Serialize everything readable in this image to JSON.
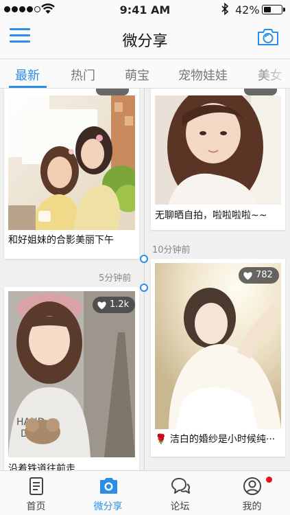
{
  "status_bar": {
    "time": "9:41 AM",
    "battery_percent": "42%",
    "battery_level": 0.42,
    "signal_filled_dots": 4,
    "icons": [
      "signal-dots-icon",
      "wifi-icon",
      "bluetooth-icon",
      "battery-icon"
    ]
  },
  "nav": {
    "title": "微分享",
    "left_icon": "menu-icon",
    "right_icon": "camera-icon"
  },
  "tabs": [
    {
      "label": "最新",
      "active": true
    },
    {
      "label": "热门",
      "active": false
    },
    {
      "label": "萌宝",
      "active": false
    },
    {
      "label": "宠物娃娃",
      "active": false
    },
    {
      "label": "美女",
      "active": false
    }
  ],
  "feed": {
    "posts": [
      {
        "caption": "和好姐妹的合影美丽下午",
        "column": "left"
      },
      {
        "caption": "无聊晒自拍，啦啦啦啦~~",
        "column": "right"
      },
      {
        "time": "10分钟前",
        "likes": "782",
        "caption": "🌹 洁白的婚纱是小时候纯···",
        "column": "right"
      },
      {
        "time": "5分钟前",
        "likes": "1.2k",
        "caption": "沿着铁道往前走",
        "column": "left"
      }
    ]
  },
  "tabbar": [
    {
      "label": "首页",
      "icon": "document-icon",
      "active": false
    },
    {
      "label": "微分享",
      "icon": "share-icon",
      "active": true
    },
    {
      "label": "论坛",
      "icon": "chat-bubbles-icon",
      "active": false
    },
    {
      "label": "我的",
      "icon": "user-icon",
      "active": false,
      "badge": "red-dot"
    }
  ],
  "colors": {
    "accent": "#2a8ee6",
    "badge_red": "#e8101e",
    "background": "#f0f0f0"
  }
}
